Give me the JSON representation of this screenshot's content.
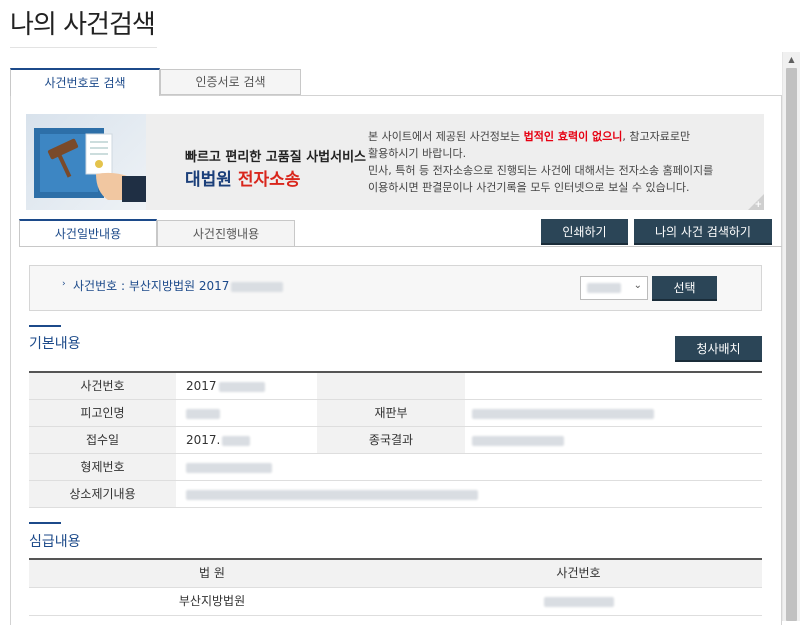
{
  "page": {
    "title": "나의 사건검색"
  },
  "outer_tabs": [
    "사건번호로 검색",
    "인증서로 검색"
  ],
  "banner": {
    "headline1": "빠르고 편리한 고품질 사법서비스",
    "headline2_blue": "대법원",
    "headline2_red": "전자소송",
    "desc_line1_pre": "본 사이트에서 제공된 사건정보는 ",
    "desc_line1_warn": "법적인 효력이 없으니",
    "desc_line1_post": ", 참고자료로만",
    "desc_line2": "활용하시기 바랍니다.",
    "desc_line3": "민사, 특허 등 전자소송으로 진행되는 사건에 대해서는 전자소송 홈페이지를",
    "desc_line4": "이용하시면 판결문이나 사건기록을 모두 인터넷으로 보실 수 있습니다.",
    "corner_symbol": "+"
  },
  "inner_tabs": [
    "사건일반내용",
    "사건진행내용"
  ],
  "actions": {
    "print": "인쇄하기",
    "my_case_search": "나의 사건 검색하기"
  },
  "case_selector": {
    "label": "사건번호 : 부산지방법원 2017",
    "select_button": "선택"
  },
  "basic_info": {
    "heading": "기본내용",
    "copy_button": "청사배치",
    "rows": [
      {
        "label": "사건번호",
        "value": "2017"
      },
      {
        "label": "피고인명",
        "value": "",
        "label2": "재판부",
        "value2": ""
      },
      {
        "label": "접수일",
        "value": "2017.",
        "label2": "종국결과",
        "value2": ""
      },
      {
        "label": "형제번호",
        "value": ""
      },
      {
        "label": "상소제기내용",
        "value": ""
      }
    ]
  },
  "trial_info": {
    "heading": "심급내용",
    "columns": [
      "법 원",
      "사건번호"
    ],
    "rows": [
      {
        "court": "부산지방법원",
        "case_no": ""
      }
    ]
  },
  "colors": {
    "brand_blue": "#1c4a8a",
    "dark_button": "#2b4557",
    "warning_red": "#e60012"
  },
  "icons": [
    "gavel-illustration",
    "chevron-down-icon",
    "arrow-right-icon",
    "scroll-up-icon"
  ]
}
